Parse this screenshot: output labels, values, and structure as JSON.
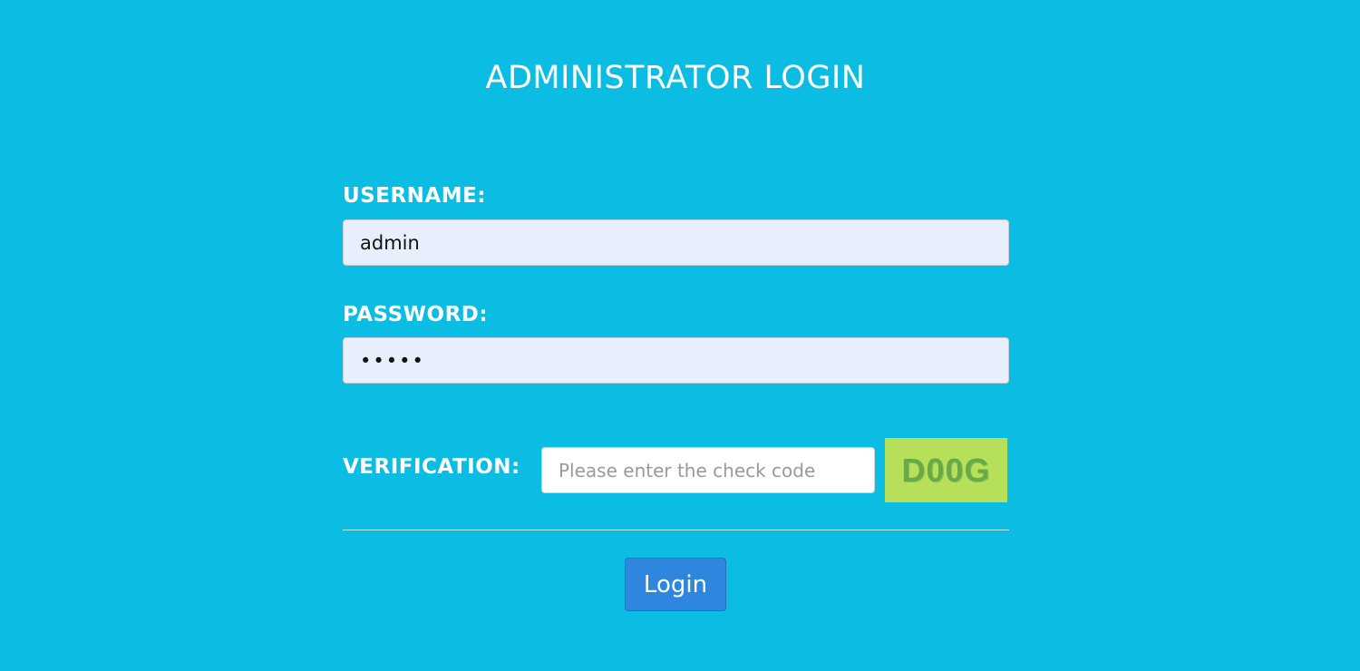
{
  "page": {
    "title": "ADMINISTRATOR LOGIN"
  },
  "form": {
    "username": {
      "label": "USERNAME:",
      "value": "admin"
    },
    "password": {
      "label": "PASSWORD:",
      "value": "•••••"
    },
    "verification": {
      "label": "VERIFICATION:",
      "placeholder": "Please enter the check code",
      "captcha_text": "D00G"
    },
    "login_label": "Login"
  },
  "colors": {
    "background": "#0bbde3",
    "input_background": "#e8effc",
    "captcha_background": "#b6e05a",
    "captcha_text": "#6aa947",
    "button": "#2f86de"
  }
}
